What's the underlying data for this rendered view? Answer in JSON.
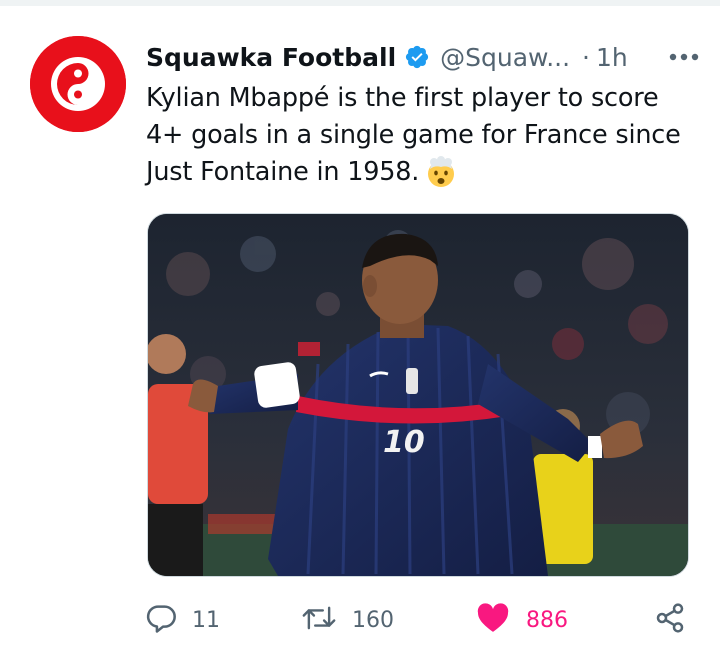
{
  "tweet": {
    "display_name": "Squawka Football",
    "handle": "@Squaw...",
    "separator": "·",
    "timestamp": "1h",
    "text_lines": [
      "Kylian Mbappé is the first player to score",
      "4+ goals in a single game for France since",
      "Just Fontaine in 1958."
    ],
    "emoji": "exploding-head-emoji",
    "media": {
      "kind": "photo",
      "jersey_number": "10"
    }
  },
  "actions": {
    "reply_count": "11",
    "retweet_count": "160",
    "like_count": "886",
    "liked": true
  },
  "icons": {
    "verified": "verified-badge-icon",
    "more": "more-icon",
    "reply": "reply-icon",
    "retweet": "retweet-icon",
    "like": "heart-icon",
    "share": "share-icon"
  },
  "colors": {
    "brand_red": "#e8101b",
    "verified_blue": "#1d9bf0",
    "like_pink": "#f91880",
    "secondary_text": "#536471"
  }
}
